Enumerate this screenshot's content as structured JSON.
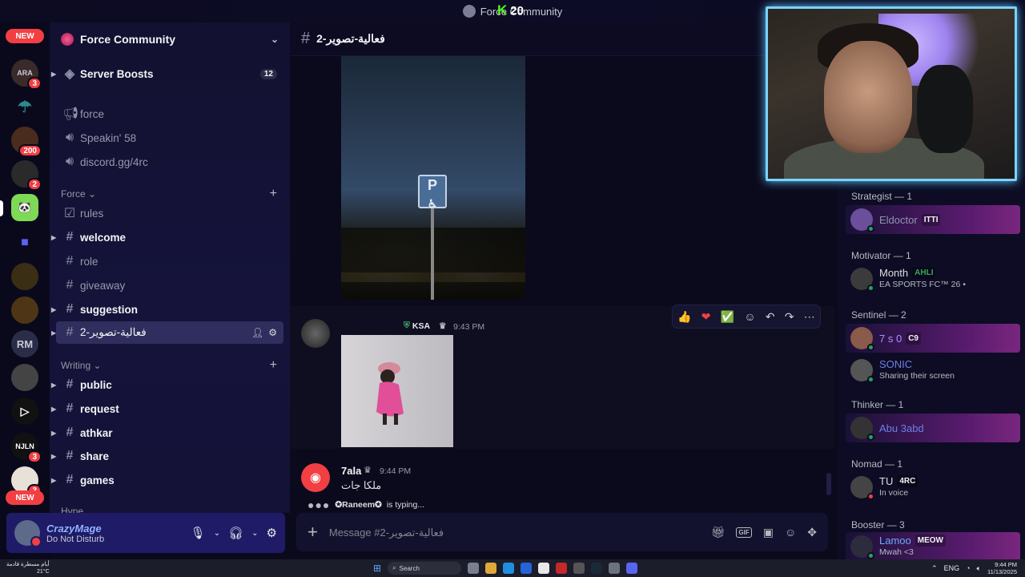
{
  "window": {
    "title": "Force Community"
  },
  "overlay": {
    "kick_count": "20",
    "kick_letter": "K"
  },
  "rail": {
    "new_top": "NEW",
    "new_bottom": "NEW",
    "badges": [
      "3",
      "200",
      "2",
      "3",
      "3"
    ],
    "rm_label": "RM"
  },
  "guild": {
    "name": "Force Community",
    "boosts_label": "Server Boosts",
    "boosts_count": "12"
  },
  "channels": {
    "top": [
      {
        "name": "force",
        "icon": "megaphone-icon"
      },
      {
        "name": "Speakin' 58",
        "icon": "speaker-icon"
      },
      {
        "name": "discord.gg/4rc",
        "icon": "speaker-icon"
      }
    ],
    "cat_force": "Force",
    "force_list": [
      {
        "name": "rules",
        "icon": "checkbox-icon"
      },
      {
        "name": "welcome",
        "icon": "hash-icon",
        "bold": true
      },
      {
        "name": "role",
        "icon": "hash-icon"
      },
      {
        "name": "giveaway",
        "icon": "hash-icon"
      },
      {
        "name": "suggestion",
        "icon": "hash-icon",
        "bold": true
      },
      {
        "name": "فعالية-تصوير-2",
        "icon": "hash-icon",
        "active": true
      }
    ],
    "cat_writing": "Writing",
    "writing_list": [
      {
        "name": "public",
        "bold": true
      },
      {
        "name": "request",
        "bold": true
      },
      {
        "name": "athkar",
        "bold": true
      },
      {
        "name": "share",
        "bold": true
      },
      {
        "name": "games",
        "bold": true
      }
    ],
    "cat_hype": "Hype"
  },
  "user": {
    "name": "CrazyMage",
    "status": "Do Not Disturb"
  },
  "chat": {
    "channel_title": "فعالية-تصوير-2",
    "photo1_sign": "P",
    "msg1": {
      "tag": "KSA",
      "time": "9:43 PM"
    },
    "msg2": {
      "name": "7ala",
      "time": "9:44 PM",
      "text": "ملكا جات"
    },
    "typing": {
      "user": "✪Raneem✪",
      "suffix": "is typing..."
    },
    "composer_placeholder": "Message #فعالية-تصوير-2"
  },
  "members": {
    "groups": [
      {
        "label": "Strategist — 1"
      },
      {
        "label": "Motivator — 1"
      },
      {
        "label": "Sentinel — 2"
      },
      {
        "label": "Thinker — 1"
      },
      {
        "label": "Nomad — 1"
      },
      {
        "label": "Booster — 3"
      }
    ],
    "list": [
      {
        "name": "Eldoctor",
        "tag": "ITTI",
        "sub": ""
      },
      {
        "name": "Month",
        "tag": "AHLI",
        "sub": "EA SPORTS FC™ 26 •"
      },
      {
        "name": "7 s 0",
        "tag": "C9",
        "sub": ""
      },
      {
        "name": "SONIC",
        "tag": "",
        "sub": "Sharing their screen"
      },
      {
        "name": "Abu 3abd",
        "tag": "",
        "sub": ""
      },
      {
        "name": "TU",
        "tag": "4RC",
        "sub": "In voice"
      },
      {
        "name": "Lamoo",
        "tag": "MEOW",
        "sub": "Mwah <3"
      }
    ]
  },
  "taskbar": {
    "weather_line1": "أيام مسطرة قادمة",
    "weather_line2": "21°C",
    "search": "Search",
    "lang": "ENG",
    "time": "9:44 PM",
    "date": "11/13/2025"
  },
  "colors": {
    "accent": "#5865f2",
    "dnd": "#f23f43",
    "online": "#23a55a",
    "cam_border": "#7ad3ff"
  }
}
